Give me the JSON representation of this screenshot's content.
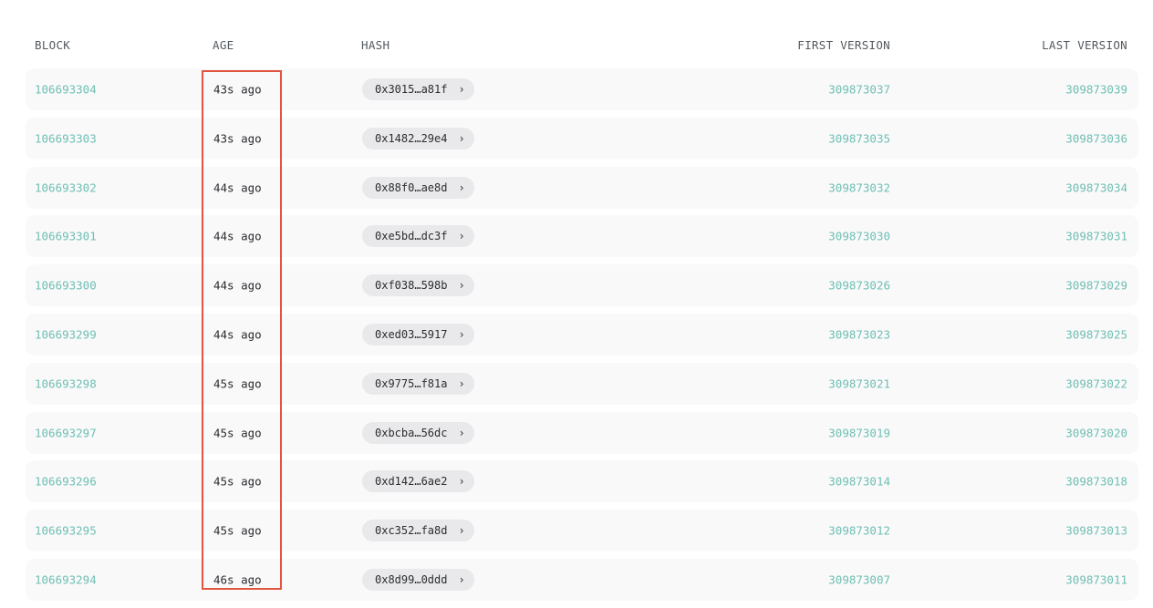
{
  "table": {
    "columns": {
      "block": "BLOCK",
      "age": "AGE",
      "hash": "HASH",
      "first_version": "FIRST VERSION",
      "last_version": "LAST VERSION"
    },
    "rows": [
      {
        "block": "106693304",
        "age": "43s ago",
        "hash": "0x3015…a81f",
        "first_version": "309873037",
        "last_version": "309873039"
      },
      {
        "block": "106693303",
        "age": "43s ago",
        "hash": "0x1482…29e4",
        "first_version": "309873035",
        "last_version": "309873036"
      },
      {
        "block": "106693302",
        "age": "44s ago",
        "hash": "0x88f0…ae8d",
        "first_version": "309873032",
        "last_version": "309873034"
      },
      {
        "block": "106693301",
        "age": "44s ago",
        "hash": "0xe5bd…dc3f",
        "first_version": "309873030",
        "last_version": "309873031"
      },
      {
        "block": "106693300",
        "age": "44s ago",
        "hash": "0xf038…598b",
        "first_version": "309873026",
        "last_version": "309873029"
      },
      {
        "block": "106693299",
        "age": "44s ago",
        "hash": "0xed03…5917",
        "first_version": "309873023",
        "last_version": "309873025"
      },
      {
        "block": "106693298",
        "age": "45s ago",
        "hash": "0x9775…f81a",
        "first_version": "309873021",
        "last_version": "309873022"
      },
      {
        "block": "106693297",
        "age": "45s ago",
        "hash": "0xbcba…56dc",
        "first_version": "309873019",
        "last_version": "309873020"
      },
      {
        "block": "106693296",
        "age": "45s ago",
        "hash": "0xd142…6ae2",
        "first_version": "309873014",
        "last_version": "309873018"
      },
      {
        "block": "106693295",
        "age": "45s ago",
        "hash": "0xc352…fa8d",
        "first_version": "309873012",
        "last_version": "309873013"
      },
      {
        "block": "106693294",
        "age": "46s ago",
        "hash": "0x8d99…0ddd",
        "first_version": "309873007",
        "last_version": "309873011"
      }
    ],
    "hash_chevron_icon": "chevron-right-icon",
    "chevron_glyph": "›"
  },
  "colors": {
    "link": "#6fbfb3",
    "highlight": "#e2553f",
    "row_bg": "#f9f9fa",
    "hash_pill_bg": "#e9e9eb"
  }
}
